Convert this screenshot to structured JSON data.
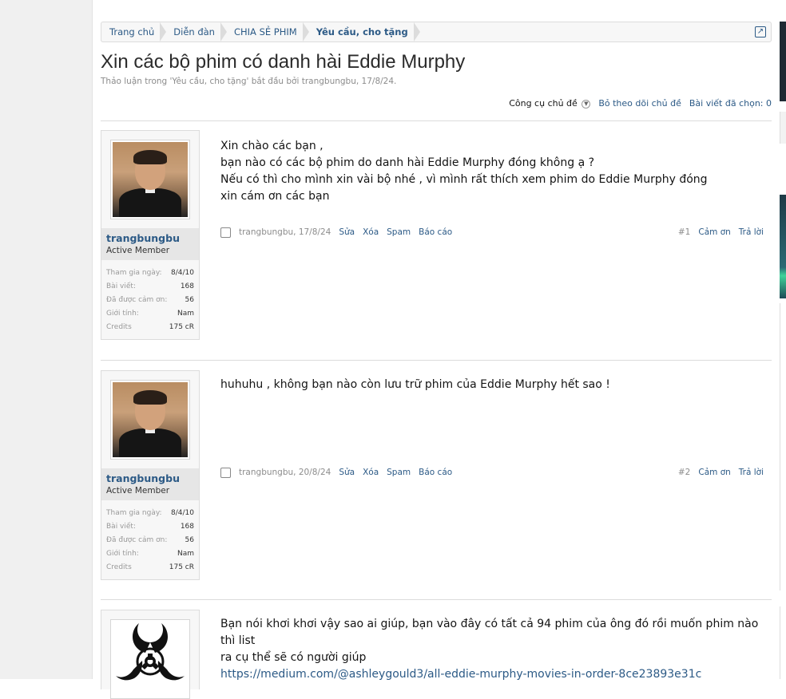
{
  "breadcrumb": [
    {
      "label": "Trang chủ"
    },
    {
      "label": "Diễn đàn"
    },
    {
      "label": "CHIA SẺ PHIM"
    },
    {
      "label": "Yêu cầu, cho tặng"
    }
  ],
  "thread": {
    "title": "Xin các bộ phim có danh hài Eddie Murphy",
    "description": "Thảo luận trong 'Yêu cầu, cho tặng' bắt đầu bởi trangbungbu, 17/8/24.",
    "tools": {
      "thread_tools": "Công cụ chủ đề",
      "unwatch": "Bỏ theo dõi chủ đề",
      "selected": "Bài viết đã chọn: 0"
    }
  },
  "labels": {
    "joined": "Tham gia ngày:",
    "posts": "Bài viết:",
    "likes": "Đã được cảm ơn:",
    "gender": "Giới tính:",
    "credits": "Credits",
    "edit": "Sửa",
    "delete": "Xóa",
    "spam": "Spam",
    "report": "Báo cáo",
    "thanks": "Cảm ơn",
    "reply": "Trả lời"
  },
  "posts": [
    {
      "user": {
        "name": "trangbungbu",
        "title": "Active Member",
        "joined": "8/4/10",
        "posts": "168",
        "likes": "56",
        "gender": "Nam",
        "credits": "175 cR"
      },
      "lines": [
        "Xin chào các bạn ,",
        "bạn nào có các bộ phim do danh hài Eddie Murphy đóng không ạ ?",
        "Nếu có thì cho mình xin vài bộ nhé , vì mình rất thích xem phim do Eddie Murphy đóng",
        "xin cám ơn các bạn"
      ],
      "meta": {
        "author_date": "trangbungbu, 17/8/24",
        "num": "#1"
      }
    },
    {
      "user": {
        "name": "trangbungbu",
        "title": "Active Member",
        "joined": "8/4/10",
        "posts": "168",
        "likes": "56",
        "gender": "Nam",
        "credits": "175 cR"
      },
      "lines": [
        "huhuhu , không bạn nào còn lưu trữ phim của Eddie Murphy hết sao !"
      ],
      "meta": {
        "author_date": "trangbungbu, 20/8/24",
        "num": "#2"
      }
    },
    {
      "lines": [
        "Bạn nói khơi khơi vậy sao ai giúp, bạn vào đây có tất cả 94 phim của ông đó rồi muốn phim nào thì list",
        "ra cụ thể sẽ có người giúp"
      ],
      "link": "https://medium.com/@ashleygould3/all-eddie-murphy-movies-in-order-8ce23893e31c"
    }
  ]
}
